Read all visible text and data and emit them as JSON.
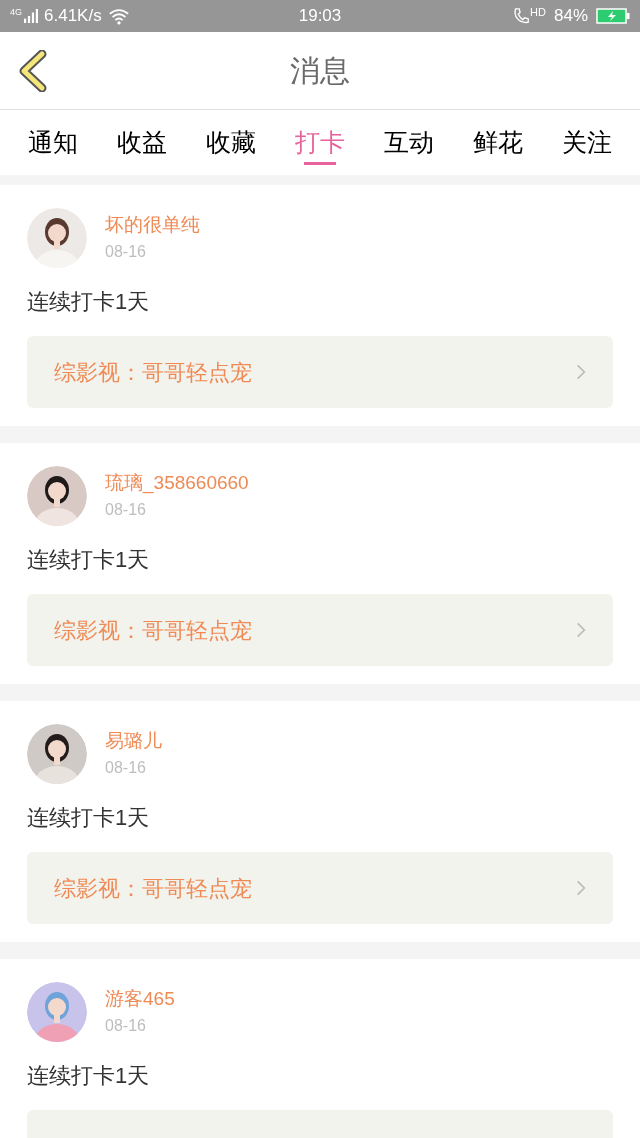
{
  "status_bar": {
    "network": "4G",
    "speed": "6.41K/s",
    "time": "19:03",
    "call": "HD",
    "battery": "84%"
  },
  "header": {
    "title": "消息"
  },
  "tabs": [
    {
      "label": "通知",
      "selected": false
    },
    {
      "label": "收益",
      "selected": false
    },
    {
      "label": "收藏",
      "selected": false
    },
    {
      "label": "打卡",
      "selected": true
    },
    {
      "label": "互动",
      "selected": false
    },
    {
      "label": "鲜花",
      "selected": false
    },
    {
      "label": "关注",
      "selected": false
    }
  ],
  "messages": [
    {
      "user": "坏的很单纯",
      "date": "08-16",
      "text": "连续打卡1天",
      "target": "综影视：哥哥轻点宠"
    },
    {
      "user": "琉璃_358660660",
      "date": "08-16",
      "text": "连续打卡1天",
      "target": "综影视：哥哥轻点宠"
    },
    {
      "user": "易璐儿",
      "date": "08-16",
      "text": "连续打卡1天",
      "target": "综影视：哥哥轻点宠"
    },
    {
      "user": "游客465",
      "date": "08-16",
      "text": "连续打卡1天"
    }
  ]
}
